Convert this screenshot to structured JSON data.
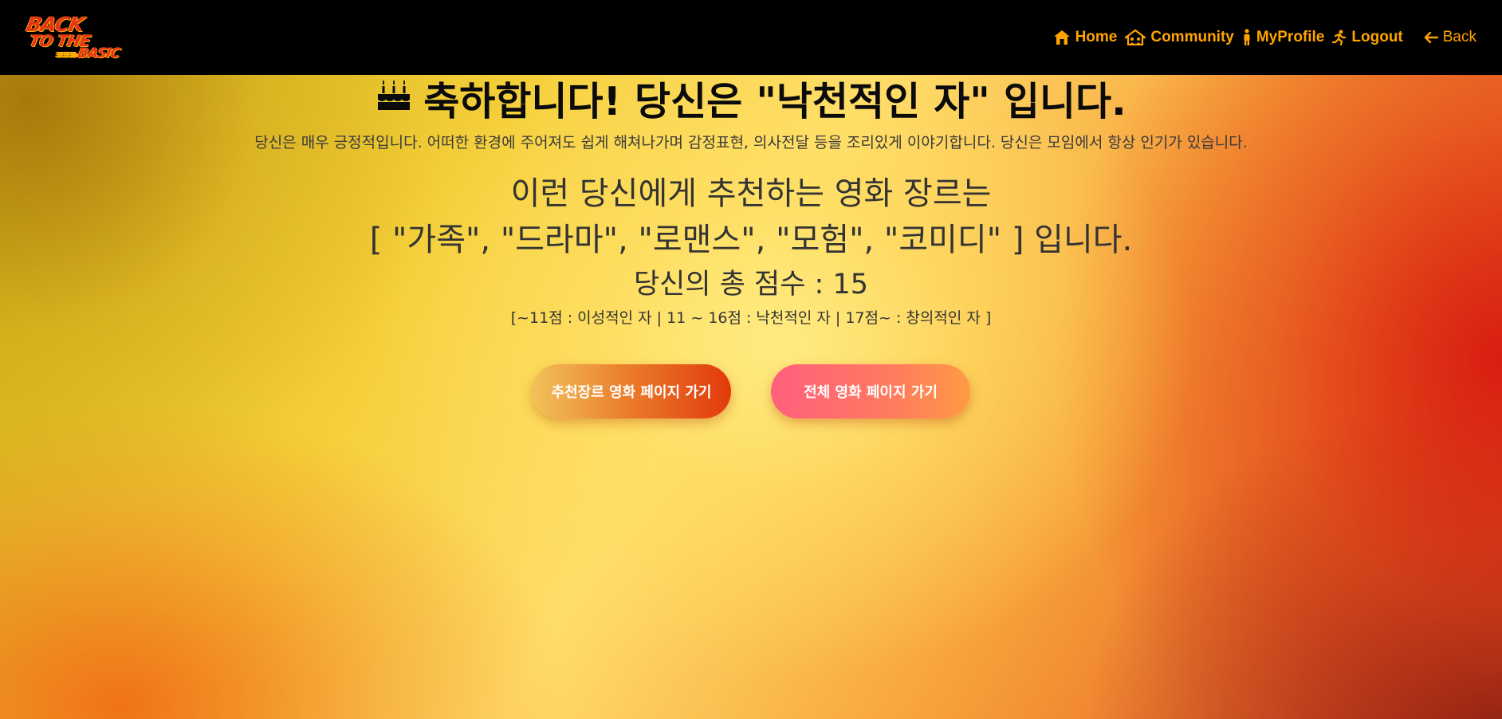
{
  "header": {
    "logo": {
      "line1": "BACK",
      "line2": "TO THE",
      "line3": "BASIC"
    },
    "nav": [
      {
        "label": "Home",
        "icon": "home-icon"
      },
      {
        "label": "Community",
        "icon": "community-icon"
      },
      {
        "label": "MyProfile",
        "icon": "person-icon"
      },
      {
        "label": "Logout",
        "icon": "running-icon"
      },
      {
        "label": "Back",
        "icon": "arrow-left-icon"
      }
    ],
    "accent_color": "#ffa400"
  },
  "result": {
    "icon": "cake-icon",
    "title": "축하합니다! 당신은 \"낙천적인 자\" 입니다.",
    "description": "당신은 매우 긍정적입니다. 어떠한 환경에 주어져도 쉽게 해쳐나가며 감정표현, 의사전달 등을 조리있게 이야기합니다. 당신은 모임에서 항상 인기가 있습니다.",
    "recommend_line1": "이런 당신에게 추천하는 영화 장르는",
    "recommend_line2": "[ \"가족\", \"드라마\", \"로맨스\", \"모험\", \"코미디\" ] 입니다.",
    "score_text": "당신의 총 점수 : 15",
    "legend": "[~11점 : 이성적인 자 | 11 ~ 16점 : 낙천적인 자 | 17점~ : 창의적인 자 ]"
  },
  "buttons": {
    "recommended": "추천장르 영화 페이지 가기",
    "all": "전체 영화 페이지 가기"
  }
}
